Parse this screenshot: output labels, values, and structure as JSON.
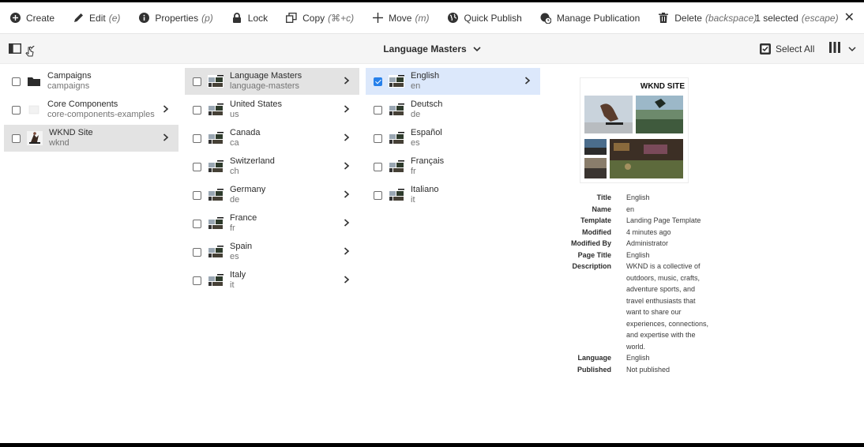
{
  "actions": [
    {
      "label": "Create",
      "shortcut": "",
      "icon": "plus-circle-icon"
    },
    {
      "label": "Edit",
      "shortcut": "(e)",
      "icon": "pencil-icon"
    },
    {
      "label": "Properties",
      "shortcut": "(p)",
      "icon": "info-icon"
    },
    {
      "label": "Lock",
      "shortcut": "",
      "icon": "lock-icon"
    },
    {
      "label": "Copy",
      "shortcut": "(⌘+c)",
      "icon": "copy-icon"
    },
    {
      "label": "Move",
      "shortcut": "(m)",
      "icon": "move-icon"
    },
    {
      "label": "Quick Publish",
      "shortcut": "",
      "icon": "globe-icon"
    },
    {
      "label": "Manage Publication",
      "shortcut": "",
      "icon": "globe-clock-icon"
    },
    {
      "label": "Delete",
      "shortcut": "(backspace)",
      "icon": "trash-icon"
    }
  ],
  "selection": {
    "count_text": "1 selected",
    "shortcut": "(escape)"
  },
  "toolbar": {
    "title": "Language Masters",
    "select_all": "Select All"
  },
  "columns": [
    [
      {
        "title": "Campaigns",
        "subtitle": "campaigns",
        "thumb": "folder",
        "state": "none",
        "arrow": false
      },
      {
        "title": "Core Components",
        "subtitle": "core-components-examples",
        "thumb": "page-blank",
        "state": "none",
        "arrow": true
      },
      {
        "title": "WKND Site",
        "subtitle": "wknd",
        "thumb": "wknd",
        "state": "grey",
        "arrow": true
      }
    ],
    [
      {
        "title": "Language Masters",
        "subtitle": "language-masters",
        "thumb": "page",
        "state": "grey",
        "arrow": true
      },
      {
        "title": "United States",
        "subtitle": "us",
        "thumb": "page",
        "state": "none",
        "arrow": true
      },
      {
        "title": "Canada",
        "subtitle": "ca",
        "thumb": "page",
        "state": "none",
        "arrow": true
      },
      {
        "title": "Switzerland",
        "subtitle": "ch",
        "thumb": "page",
        "state": "none",
        "arrow": true
      },
      {
        "title": "Germany",
        "subtitle": "de",
        "thumb": "page",
        "state": "none",
        "arrow": true
      },
      {
        "title": "France",
        "subtitle": "fr",
        "thumb": "page",
        "state": "none",
        "arrow": true
      },
      {
        "title": "Spain",
        "subtitle": "es",
        "thumb": "page",
        "state": "none",
        "arrow": true
      },
      {
        "title": "Italy",
        "subtitle": "it",
        "thumb": "page",
        "state": "none",
        "arrow": true
      }
    ],
    [
      {
        "title": "English",
        "subtitle": "en",
        "thumb": "page",
        "state": "blue",
        "arrow": true
      },
      {
        "title": "Deutsch",
        "subtitle": "de",
        "thumb": "page",
        "state": "none",
        "arrow": false
      },
      {
        "title": "Español",
        "subtitle": "es",
        "thumb": "page",
        "state": "none",
        "arrow": false
      },
      {
        "title": "Français",
        "subtitle": "fr",
        "thumb": "page",
        "state": "none",
        "arrow": false
      },
      {
        "title": "Italiano",
        "subtitle": "it",
        "thumb": "page",
        "state": "none",
        "arrow": false
      }
    ]
  ],
  "details": {
    "preview_title": "WKND SITE",
    "rows": [
      {
        "key": "Title",
        "value": "English"
      },
      {
        "key": "Name",
        "value": "en"
      },
      {
        "key": "Template",
        "value": "Landing Page Template"
      },
      {
        "key": "Modified",
        "value": "4 minutes ago"
      },
      {
        "key": "Modified By",
        "value": "Administrator"
      },
      {
        "key": "Page Title",
        "value": "English"
      },
      {
        "key": "Description",
        "value": "WKND is a collective of outdoors, music, crafts, adventure sports, and travel enthusiasts that want to share our experiences, connections, and expertise with the world."
      },
      {
        "key": "Language",
        "value": "English"
      },
      {
        "key": "Published",
        "value": "Not published"
      }
    ]
  },
  "colors": {
    "accent": "#2680eb",
    "selected_grey": "#e3e3e3",
    "selected_blue": "#dce8fb"
  }
}
